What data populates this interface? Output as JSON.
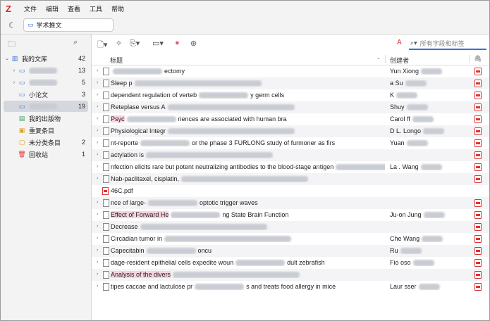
{
  "app": {
    "logo": "Z"
  },
  "menu": [
    "文件",
    "编辑",
    "查看",
    "工具",
    "帮助"
  ],
  "tab": {
    "label": "学术推文"
  },
  "library": {
    "items": [
      {
        "label": "我的文库",
        "count": "42",
        "icon": "library-icon",
        "twisty": "open"
      },
      {
        "label": "",
        "count": "13",
        "icon": "folder-icon",
        "twisty": "closed",
        "blurred": true
      },
      {
        "label": "",
        "count": "5",
        "icon": "folder-icon",
        "twisty": "closed",
        "blurred": true
      },
      {
        "label": "小论文",
        "count": "3",
        "icon": "folder-icon",
        "twisty": ""
      },
      {
        "label": "",
        "count": "19",
        "icon": "folder-icon",
        "twisty": "",
        "blurred": true,
        "selected": true
      },
      {
        "label": "我的出版物",
        "count": "",
        "icon": "publications-icon",
        "twisty": ""
      },
      {
        "label": "重复条目",
        "count": "",
        "icon": "duplicates-icon",
        "twisty": ""
      },
      {
        "label": "未分类条目",
        "count": "2",
        "icon": "unfiled-icon",
        "twisty": ""
      },
      {
        "label": "回收站",
        "count": "1",
        "icon": "trash-icon",
        "twisty": ""
      }
    ]
  },
  "search": {
    "placeholder": "所有字段和标签"
  },
  "columns": {
    "title": "标题",
    "creator": "创建者"
  },
  "rows": [
    {
      "a": "",
      "hl": "",
      "b": "ectomy",
      "creator": "Yun Xiong",
      "arrow": true
    },
    {
      "a": "Sleep p",
      "hl": "",
      "b": "",
      "creator": "a Su",
      "arrow": true
    },
    {
      "a": "dependent regulation of verteb",
      "hl": "",
      "b": "y germ cells",
      "creator": "K",
      "arrow": true
    },
    {
      "a": "Reteplase versus A",
      "hl": "",
      "b": "",
      "creator": "Shuy",
      "arrow": true
    },
    {
      "a": "Psyc",
      "hl": "Psyc",
      "b": "riences are associated with human bra",
      "creator": "Carol ff",
      "arrow": true
    },
    {
      "a": "Physiological Integr",
      "hl": "",
      "b": "",
      "creator": "D L. Longo",
      "arrow": true
    },
    {
      "a": "nt-reporte",
      "hl": "",
      "b": "or the phase 3 FURLONG study of furmoner as firs",
      "creator": "Yuan",
      "arrow": true
    },
    {
      "a": "actylation is",
      "hl": "",
      "b": "",
      "creator": "",
      "arrow": true
    },
    {
      "a": "nfection elicits rare but potent neutralizing antibodies to the blood-stage antigen",
      "hl": "",
      "b": "",
      "creator": "La . Wang",
      "arrow": true
    },
    {
      "a": "Nab-paclitaxel, cisplatin,",
      "hl": "",
      "b": "",
      "creator": "",
      "arrow": true
    },
    {
      "a": "46C.pdf",
      "hl": "",
      "b": "",
      "creator": "",
      "arrow": false,
      "pdf": true
    },
    {
      "a": "nce of large-",
      "hl": "",
      "b": "optotic trigger waves",
      "creator": "",
      "arrow": true
    },
    {
      "a": "Effect of Forward He",
      "hl": "Effect of Forward He",
      "b": "ng State Brain Function",
      "creator": "Ju-on Jung",
      "arrow": true
    },
    {
      "a": "Decrease",
      "hl": "",
      "b": "",
      "creator": "",
      "arrow": true
    },
    {
      "a": "Circadian tumor in",
      "hl": "",
      "b": "",
      "creator": "Che Wang",
      "arrow": true
    },
    {
      "a": "Capecitabin",
      "hl": "",
      "b": "oncu",
      "creator": "Ru",
      "arrow": true
    },
    {
      "a": "dage-resident epithelial cells expedite woun",
      "hl": "",
      "b": "dult zebrafish",
      "creator": "Fio oso",
      "arrow": true
    },
    {
      "a": "Analysis of the divers",
      "hl": "Analysis of the divers",
      "b": "",
      "creator": "",
      "arrow": true
    },
    {
      "a": "tipes caccae and lactulose pr",
      "hl": "",
      "b": "s and treats food allergy in mice",
      "creator": "Laur sser",
      "arrow": true
    }
  ]
}
